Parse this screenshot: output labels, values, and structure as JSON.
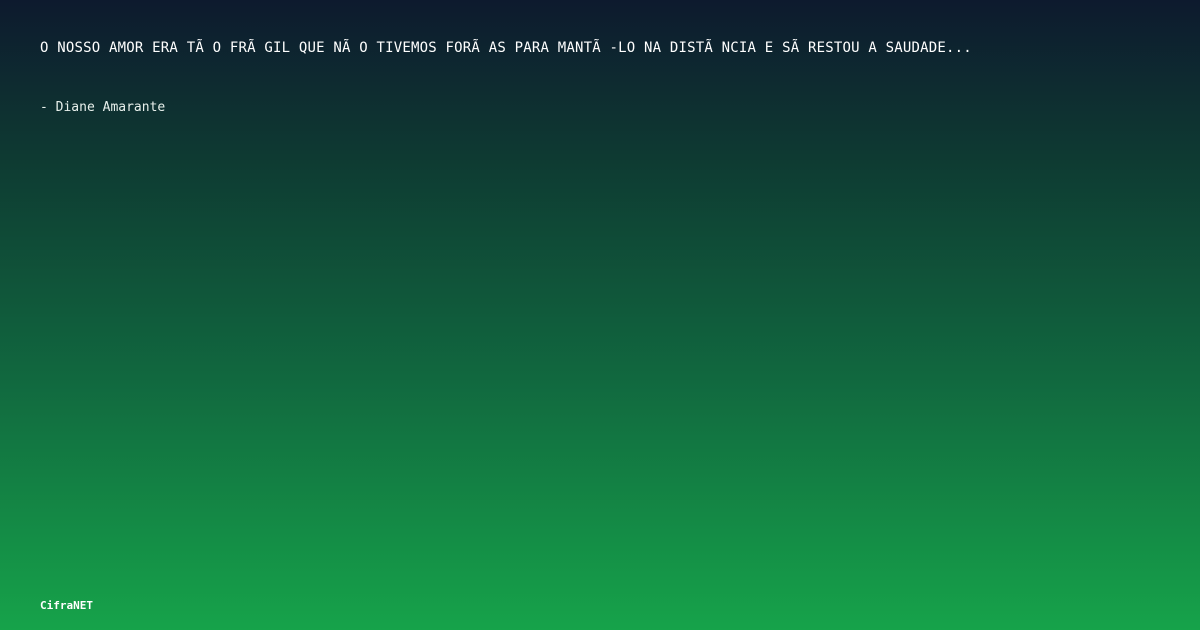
{
  "quote": {
    "text": "O NOSSO AMOR ERA TÃ O FRÃ GIL QUE NÃ O TIVEMOS FORÃ AS PARA MANTÃ -LO NA DISTÃ NCIA E SÃ  RESTOU A SAUDADE..."
  },
  "author": {
    "text": "- Diane Amarante"
  },
  "brand": {
    "name": "CifraNET"
  },
  "colors": {
    "gradient_top": "#0d1a2e",
    "gradient_bottom": "#16a34a",
    "text": "#ffffff"
  }
}
